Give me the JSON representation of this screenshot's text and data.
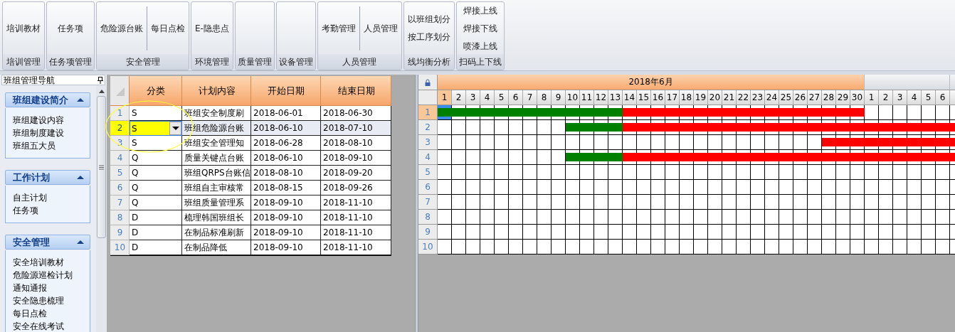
{
  "ribbon": {
    "groups": [
      {
        "label": "培训管理",
        "kind": "row",
        "buttons": [
          "培训教材"
        ]
      },
      {
        "label": "任务项管理",
        "kind": "row",
        "buttons": [
          "任务项"
        ]
      },
      {
        "label": "安全管理",
        "kind": "row",
        "buttons": [
          "危险源台账",
          "每日点检"
        ]
      },
      {
        "label": "环境管理",
        "kind": "row",
        "buttons": [
          "E-隐患点"
        ]
      },
      {
        "label": "质量管理",
        "kind": "row"
      },
      {
        "label": "设备管理",
        "kind": "row"
      },
      {
        "label": "人员管理",
        "kind": "row",
        "buttons": [
          "考勤管理",
          "人员管理"
        ]
      },
      {
        "label": "线均衡分析",
        "kind": "stack",
        "buttons": [
          "以班组划分",
          "按工序划分"
        ]
      },
      {
        "label": "扫码上下线",
        "kind": "stack",
        "buttons": [
          "焊接上线",
          "焊接下线",
          "喷漆上线"
        ]
      }
    ]
  },
  "navigator": {
    "title": "班组管理导航",
    "sections": [
      {
        "title": "班组建设简介",
        "expanded": true,
        "items": [
          "班组建设内容",
          "班组制度建设",
          "班组五大员"
        ]
      },
      {
        "title": "工作计划",
        "expanded": true,
        "items": [
          "自主计划",
          "任务项"
        ]
      },
      {
        "title": "安全管理",
        "expanded": true,
        "items": [
          "安全培训教材",
          "危险源巡检计划",
          "通知通报",
          "安全隐患梳理",
          "每日点检",
          "安全在线考试"
        ]
      }
    ]
  },
  "grid": {
    "columns": [
      "分类",
      "计划内容",
      "开始日期",
      "结束日期"
    ],
    "rows": [
      {
        "number": "1",
        "selected": false,
        "cells": [
          "S",
          "班组安全制度刷",
          "2018-06-01",
          "2018-06-30"
        ]
      },
      {
        "number": "2",
        "selected": true,
        "cells": [
          "S",
          "班组危险源台账",
          "2018-06-10",
          "2018-07-10"
        ]
      },
      {
        "number": "3",
        "selected": false,
        "cells": [
          "S",
          "班组安全管理知",
          "2018-06-28",
          "2018-08-10"
        ]
      },
      {
        "number": "4",
        "selected": false,
        "cells": [
          "Q",
          "质量关键点台账",
          "2018-06-10",
          "2018-09-10"
        ]
      },
      {
        "number": "5",
        "selected": false,
        "cells": [
          "Q",
          "班组QRPS台账信",
          "2018-08-10",
          "2018-09-20"
        ]
      },
      {
        "number": "6",
        "selected": false,
        "cells": [
          "Q",
          "班组自主审核常",
          "2018-08-15",
          "2018-09-26"
        ]
      },
      {
        "number": "7",
        "selected": false,
        "cells": [
          "Q",
          "班组质量管理系",
          "2018-09-10",
          "2018-11-10"
        ]
      },
      {
        "number": "8",
        "selected": false,
        "cells": [
          "D",
          "梳理韩国班组长",
          "2018-09-10",
          "2018-11-10"
        ]
      },
      {
        "number": "9",
        "selected": false,
        "cells": [
          "D",
          "在制品标准刷新",
          "2018-09-10",
          "2018-11-10"
        ]
      },
      {
        "number": "10",
        "selected": false,
        "cells": [
          "D",
          "在制品降低",
          "2018-09-10",
          "2018-11-10"
        ]
      }
    ]
  },
  "gantt": {
    "months": [
      {
        "label": "2018年6月",
        "days": [
          {
            "label": "1",
            "selected": true,
            "elapsed": true
          },
          {
            "label": "2",
            "selected": false,
            "elapsed": true
          },
          {
            "label": "3",
            "selected": false,
            "elapsed": true
          },
          {
            "label": "4",
            "selected": false,
            "elapsed": true
          },
          {
            "label": "5",
            "selected": false,
            "elapsed": true
          },
          {
            "label": "6",
            "selected": false,
            "elapsed": true
          },
          {
            "label": "7",
            "selected": false,
            "elapsed": true
          },
          {
            "label": "8",
            "selected": false,
            "elapsed": true
          },
          {
            "label": "9",
            "selected": false,
            "elapsed": true
          },
          {
            "label": "10",
            "selected": false,
            "elapsed": true
          },
          {
            "label": "11",
            "selected": false,
            "elapsed": true
          },
          {
            "label": "12",
            "selected": false,
            "elapsed": true
          },
          {
            "label": "13",
            "selected": false,
            "elapsed": true
          },
          {
            "label": "14",
            "selected": false,
            "elapsed": false
          },
          {
            "label": "15",
            "selected": false,
            "elapsed": false
          },
          {
            "label": "16",
            "selected": false,
            "elapsed": false
          },
          {
            "label": "17",
            "selected": false,
            "elapsed": false
          },
          {
            "label": "18",
            "selected": false,
            "elapsed": false
          },
          {
            "label": "19",
            "selected": false,
            "elapsed": false
          },
          {
            "label": "20",
            "selected": false,
            "elapsed": false
          },
          {
            "label": "21",
            "selected": false,
            "elapsed": false
          },
          {
            "label": "22",
            "selected": false,
            "elapsed": false
          },
          {
            "label": "23",
            "selected": false,
            "elapsed": false
          },
          {
            "label": "24",
            "selected": false,
            "elapsed": false
          },
          {
            "label": "25",
            "selected": false,
            "elapsed": false
          },
          {
            "label": "26",
            "selected": false,
            "elapsed": false
          },
          {
            "label": "27",
            "selected": false,
            "elapsed": false
          },
          {
            "label": "28",
            "selected": false,
            "elapsed": false
          },
          {
            "label": "29",
            "selected": false,
            "elapsed": false
          },
          {
            "label": "30",
            "selected": false,
            "elapsed": false
          }
        ]
      },
      {
        "days": [
          {
            "label": "1",
            "selected": false,
            "elapsed": false
          },
          {
            "label": "2",
            "selected": false,
            "elapsed": false
          },
          {
            "label": "3",
            "selected": false,
            "elapsed": false
          },
          {
            "label": "4",
            "selected": false,
            "elapsed": false
          },
          {
            "label": "5",
            "selected": false,
            "elapsed": false
          },
          {
            "label": "6",
            "selected": false,
            "elapsed": false
          }
        ]
      }
    ],
    "rows": [
      {
        "number": "1",
        "selected": true
      },
      {
        "number": "2",
        "selected": false
      },
      {
        "number": "3",
        "selected": false
      },
      {
        "number": "4",
        "selected": false
      },
      {
        "number": "5",
        "selected": false
      },
      {
        "number": "6",
        "selected": false
      },
      {
        "number": "7",
        "selected": false
      },
      {
        "number": "8",
        "selected": false
      },
      {
        "number": "9",
        "selected": false
      },
      {
        "number": "10",
        "selected": false
      }
    ]
  }
}
